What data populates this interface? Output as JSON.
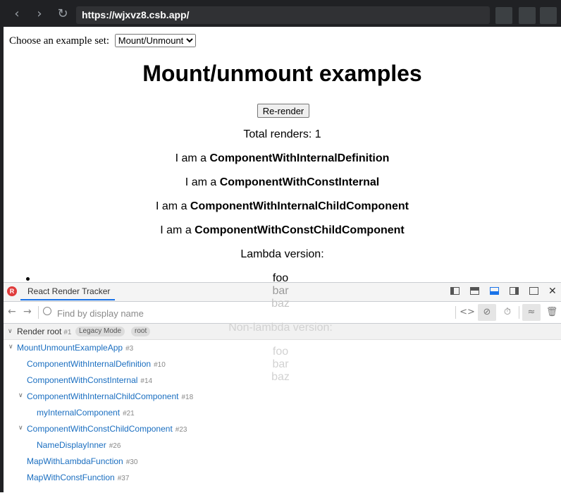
{
  "browser": {
    "url": "https://wjxvz8.csb.app/"
  },
  "page": {
    "choose_label": "Choose an example set:",
    "select_value": "Mount/Unmount",
    "title": "Mount/unmount examples",
    "rerender_label": "Re-render",
    "total_renders": "Total renders: 1",
    "lines": [
      {
        "prefix": "I am a ",
        "name": "ComponentWithInternalDefinition"
      },
      {
        "prefix": "I am a ",
        "name": "ComponentWithConstInternal"
      },
      {
        "prefix": "I am a ",
        "name": "ComponentWithInternalChildComponent"
      },
      {
        "prefix": "I am a ",
        "name": "ComponentWithConstChildComponent"
      }
    ],
    "lambda_label": "Lambda version:",
    "lambda_items": [
      "foo",
      "bar",
      "baz"
    ],
    "nonlambda_label": "Non-lambda version:",
    "nonlambda_items": [
      "foo",
      "bar",
      "baz"
    ]
  },
  "devtools": {
    "tab_label": "React Render Tracker",
    "search_placeholder": "Find by display name",
    "root": {
      "label": "Render root",
      "id": "#1",
      "badges": [
        "Legacy Mode",
        "root"
      ]
    },
    "tree": [
      {
        "name": "MountUnmountExampleApp",
        "id": "#3"
      },
      {
        "name": "ComponentWithInternalDefinition",
        "id": "#10"
      },
      {
        "name": "ComponentWithConstInternal",
        "id": "#14"
      },
      {
        "name": "ComponentWithInternalChildComponent",
        "id": "#18"
      },
      {
        "name": "myInternalComponent",
        "id": "#21"
      },
      {
        "name": "ComponentWithConstChildComponent",
        "id": "#23"
      },
      {
        "name": "NameDisplayInner",
        "id": "#26"
      },
      {
        "name": "MapWithLambdaFunction",
        "id": "#30"
      },
      {
        "name": "MapWithConstFunction",
        "id": "#37"
      }
    ]
  }
}
